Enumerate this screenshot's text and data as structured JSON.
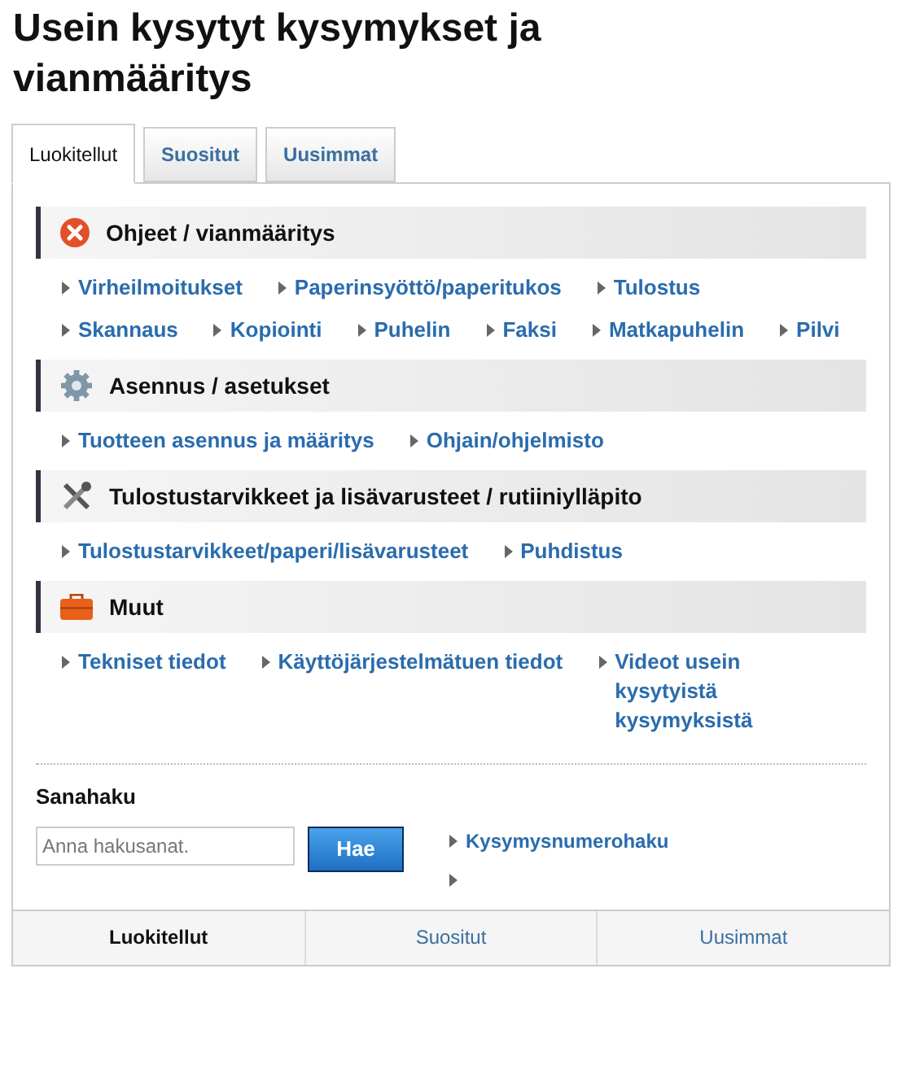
{
  "title": "Usein kysytyt kysymykset ja vianmääritys",
  "tabs": [
    {
      "label": "Luokitellut",
      "selected": true
    },
    {
      "label": "Suositut",
      "selected": false
    },
    {
      "label": "Uusimmat",
      "selected": false
    }
  ],
  "categories": [
    {
      "kind": "error",
      "title": "Ohjeet / vianmääritys",
      "links": [
        "Virheilmoitukset",
        "Paperinsyöttö/paperitukos",
        "Tulostus",
        "Skannaus",
        "Kopiointi",
        "Puhelin",
        "Faksi",
        "Matkapuhelin",
        "Pilvi"
      ]
    },
    {
      "kind": "gear",
      "title": "Asennus / asetukset",
      "links": [
        "Tuotteen asennus ja määritys",
        "Ohjain/ohjelmisto"
      ]
    },
    {
      "kind": "tools",
      "title": "Tulostustarvikkeet ja lisävarusteet / rutiiniylläpito",
      "links": [
        "Tulostustarvikkeet/paperi/lisävarusteet",
        "Puhdistus"
      ]
    },
    {
      "kind": "toolbox",
      "title": "Muut",
      "links": [
        "Tekniset tiedot",
        "Käyttöjärjestelmätuen tiedot",
        "Videot usein kysytyistä kysymyksistä"
      ]
    }
  ],
  "search": {
    "heading": "Sanahaku",
    "placeholder": "Anna hakusanat.",
    "button": "Hae",
    "links": [
      "Kysymysnumerohaku"
    ]
  },
  "bottom_tabs": [
    {
      "label": "Luokitellut",
      "selected": true
    },
    {
      "label": "Suositut",
      "selected": false
    },
    {
      "label": "Uusimmat",
      "selected": false
    }
  ]
}
